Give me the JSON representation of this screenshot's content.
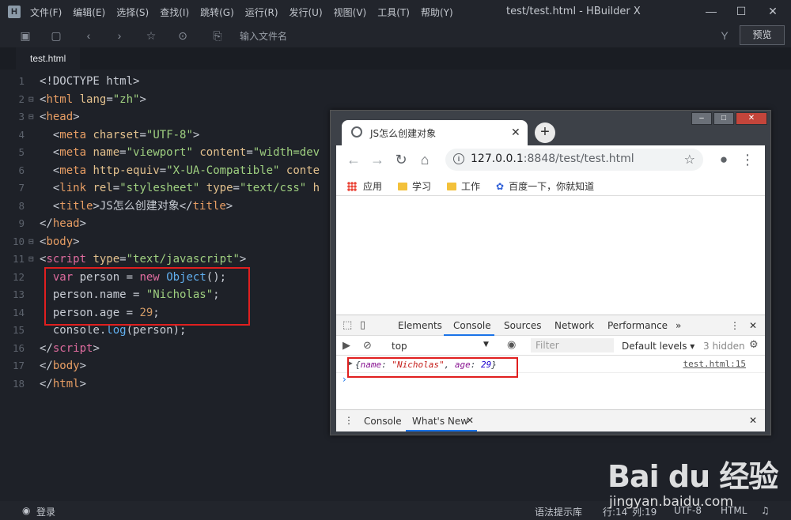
{
  "app": {
    "window_title": "test/test.html - HBuilder X",
    "menu": [
      "文件(F)",
      "编辑(E)",
      "选择(S)",
      "查找(I)",
      "跳转(G)",
      "运行(R)",
      "发行(U)",
      "视图(V)",
      "工具(T)",
      "帮助(Y)"
    ],
    "file_input_placeholder": "输入文件名",
    "preview_label": "预览",
    "tab_name": "test.html"
  },
  "editor": {
    "line_numbers": [
      "1",
      "2",
      "3",
      "4",
      "5",
      "6",
      "7",
      "8",
      "9",
      "10",
      "11",
      "12",
      "13",
      "14",
      "15",
      "16",
      "17",
      "18"
    ]
  },
  "statusbar": {
    "login": "登录",
    "syntax_hint": "语法提示库",
    "row": "行:14",
    "col": "列:19",
    "encoding": "UTF-8",
    "language": "HTML"
  },
  "browser": {
    "tab_title": "JS怎么创建对象",
    "url_host": "127.0.0.1",
    "url_rest": ":8848/test/test.html",
    "bookmarks": [
      "应用",
      "学习",
      "工作",
      "百度一下，你就知道"
    ]
  },
  "devtools": {
    "tabs": [
      "Elements",
      "Console",
      "Sources",
      "Network",
      "Performance"
    ],
    "context": "top",
    "filter_placeholder": "Filter",
    "levels": "Default levels ▾",
    "hidden": "3 hidden",
    "log_prefix": "{",
    "log_key1": "name",
    "log_val1": "\"Nicholas\"",
    "log_key2": "age",
    "log_val2": "29",
    "log_suffix": "}",
    "source_link": "test.html:15",
    "drawer_tabs": [
      "Console",
      "What's New"
    ]
  },
  "watermark": {
    "logo": "Bai du 经验",
    "url": "jingyan.baidu.com"
  },
  "colors": {
    "editor_bg": "#1e2128",
    "highlight_red": "#e01f1f",
    "chrome_blue": "#1a73e8"
  }
}
